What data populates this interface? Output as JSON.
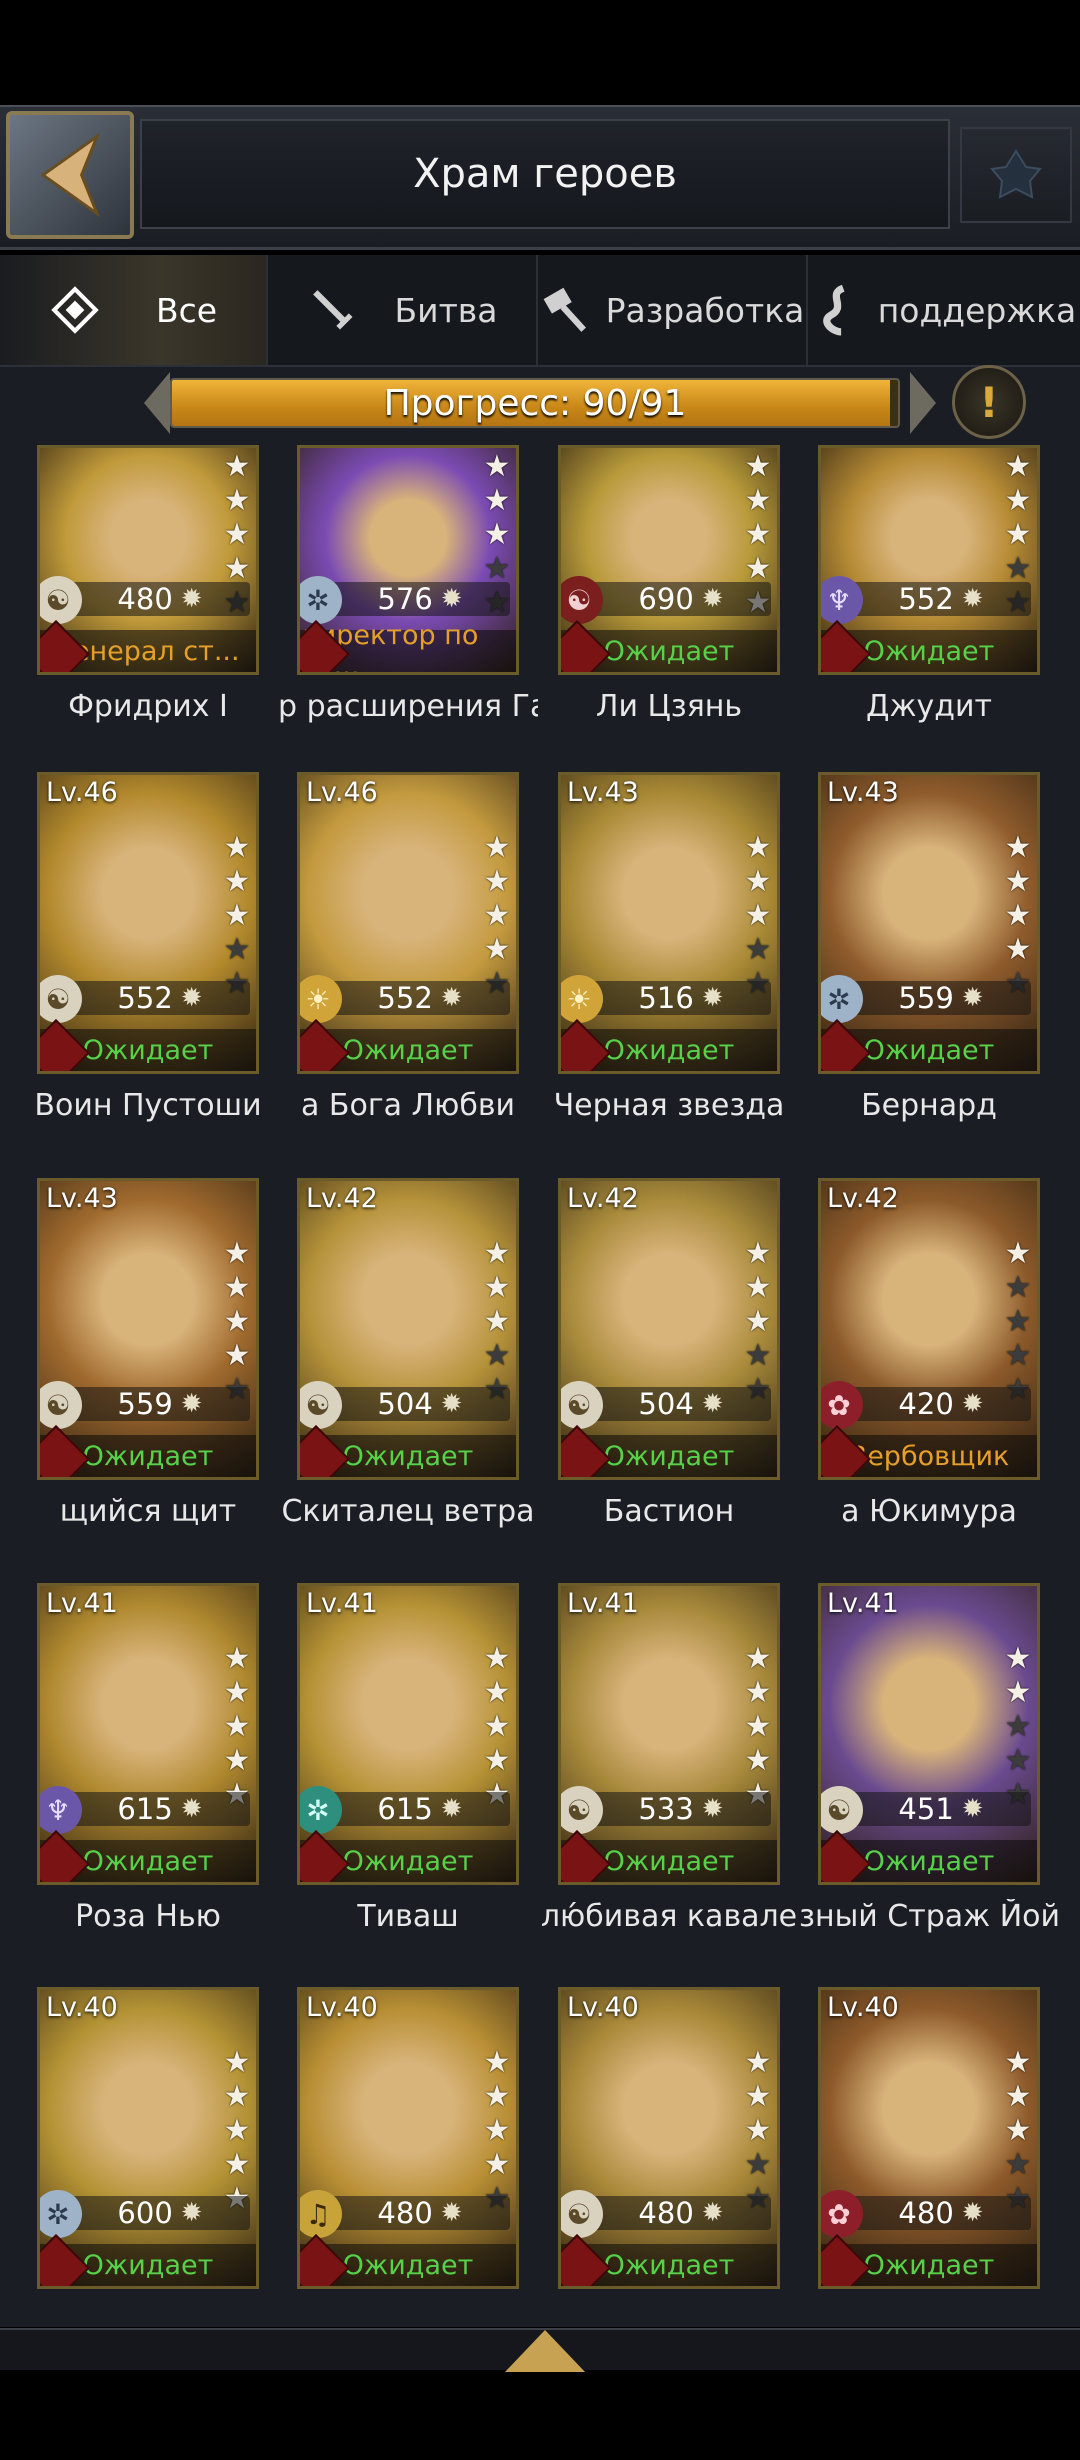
{
  "header": {
    "title": "Храм героев",
    "back_icon": "back-arrow-icon",
    "corner_icon": "emblem-icon"
  },
  "tabs": [
    {
      "label": "Все",
      "icon": "diamond-icon",
      "active": true
    },
    {
      "label": "Битва",
      "icon": "sword-icon",
      "active": false
    },
    {
      "label": "Разработка",
      "icon": "hammer-icon",
      "active": false
    },
    {
      "label": "поддержка",
      "icon": "scroll-icon",
      "active": false
    }
  ],
  "progress": {
    "text": "Прогресс: 90/91",
    "fraction": 0.989
  },
  "info_icon": "!",
  "heroes": [
    {
      "name": "Фридрих I",
      "level": "",
      "power": "480",
      "status": "Генерал ст...",
      "status_kind": "recruit",
      "faction": "dragon",
      "color": "#c09a3a",
      "stars": 4
    },
    {
      "name": "р расширения Га",
      "level": "",
      "power": "576",
      "status": "директор по ра...",
      "status_kind": "recruit",
      "faction": "knot",
      "color": "#7b4bb3",
      "stars": 3
    },
    {
      "name": "Ли Цзянь",
      "level": "",
      "power": "690",
      "status": "Ожидает",
      "status_kind": "wait",
      "faction": "red-dragon",
      "color": "#b89a3a",
      "stars": 5
    },
    {
      "name": "Джудит",
      "level": "",
      "power": "552",
      "status": "Ожидает",
      "status_kind": "wait",
      "faction": "trident",
      "color": "#b68b35",
      "stars": 3
    },
    {
      "name": "Воин Пустоши",
      "level": "Lv.46",
      "power": "552",
      "status": "Ожидает",
      "status_kind": "wait",
      "faction": "dragon",
      "color": "#b38a2d",
      "stars": 3
    },
    {
      "name": "а Бога Любви",
      "level": "Lv.46",
      "power": "552",
      "status": "Ожидает",
      "status_kind": "wait",
      "faction": "sun",
      "color": "#c39a3e",
      "stars": 4
    },
    {
      "name": "Черная звезда",
      "level": "Lv.43",
      "power": "516",
      "status": "Ожидает",
      "status_kind": "wait",
      "faction": "sun",
      "color": "#a98a35",
      "stars": 3
    },
    {
      "name": "Бернард",
      "level": "Lv.43",
      "power": "559",
      "status": "Ожидает",
      "status_kind": "wait",
      "faction": "knot",
      "color": "#8f5c2c",
      "stars": 4
    },
    {
      "name": "щийся щит",
      "level": "Lv.43",
      "power": "559",
      "status": "Ожидает",
      "status_kind": "wait",
      "faction": "dragon",
      "color": "#a06a2e",
      "stars": 4
    },
    {
      "name": "Скиталец ветра",
      "level": "Lv.42",
      "power": "504",
      "status": "Ожидает",
      "status_kind": "wait",
      "faction": "dragon",
      "color": "#b5923a",
      "stars": 3
    },
    {
      "name": "Бастион",
      "level": "Lv.42",
      "power": "504",
      "status": "Ожидает",
      "status_kind": "wait",
      "faction": "dragon",
      "color": "#a98b3b",
      "stars": 3
    },
    {
      "name": "а Юкимура",
      "level": "Lv.42",
      "power": "420",
      "status": "Вербовщик",
      "status_kind": "recruit",
      "faction": "rose",
      "color": "#8c5a2a",
      "stars": 1
    },
    {
      "name": "Роза Нью",
      "level": "Lv.41",
      "power": "615",
      "status": "Ожидает",
      "status_kind": "wait",
      "faction": "trident",
      "color": "#b0892f",
      "stars": 5
    },
    {
      "name": "Тиваш",
      "level": "Lv.41",
      "power": "615",
      "status": "Ожидает",
      "status_kind": "wait",
      "faction": "teal-knot",
      "color": "#b69235",
      "stars": 5
    },
    {
      "name": "лю́бивая кавале",
      "level": "Lv.41",
      "power": "533",
      "status": "Ожидает",
      "status_kind": "wait",
      "faction": "dragon",
      "color": "#a6883a",
      "stars": 5
    },
    {
      "name": "зный Страж Йойл",
      "level": "Lv.41",
      "power": "451",
      "status": "Ожидает",
      "status_kind": "wait",
      "faction": "dragon",
      "color": "#6a4a8f",
      "stars": 2
    },
    {
      "name": "",
      "level": "Lv.40",
      "power": "600",
      "status": "Ожидает",
      "status_kind": "wait",
      "faction": "knot",
      "color": "#b39234",
      "stars": 5
    },
    {
      "name": "",
      "level": "Lv.40",
      "power": "480",
      "status": "Ожидает",
      "status_kind": "wait",
      "faction": "bell",
      "color": "#b88f34",
      "stars": 4
    },
    {
      "name": "",
      "level": "Lv.40",
      "power": "480",
      "status": "Ожидает",
      "status_kind": "wait",
      "faction": "dragon",
      "color": "#a88838",
      "stars": 3
    },
    {
      "name": "",
      "level": "Lv.40",
      "power": "480",
      "status": "Ожидает",
      "status_kind": "wait",
      "faction": "rose",
      "color": "#8d5a2a",
      "stars": 3
    }
  ]
}
